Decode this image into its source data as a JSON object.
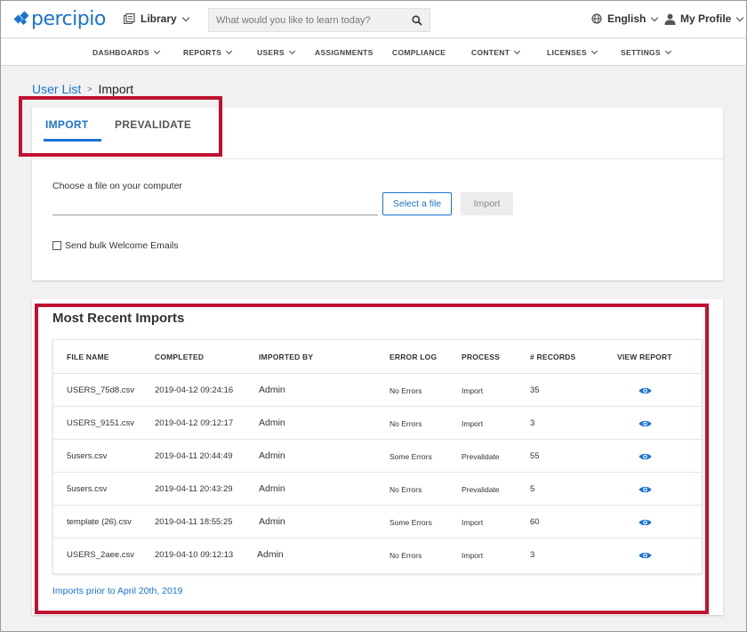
{
  "header": {
    "logo_text": "percipio",
    "library_label": "Library",
    "search_placeholder": "What would you like to learn today?",
    "language_label": "English",
    "profile_label": "My Profile"
  },
  "nav": {
    "items": [
      "DASHBOARDS",
      "REPORTS",
      "USERS",
      "ASSIGNMENTS",
      "COMPLIANCE",
      "CONTENT",
      "LICENSES",
      "SETTINGS"
    ]
  },
  "breadcrumb": {
    "parent": "User List",
    "separator": ">",
    "current": "Import"
  },
  "import_card": {
    "tabs": [
      "IMPORT",
      "PREVALIDATE"
    ],
    "active_tab": "IMPORT",
    "choose_label": "Choose a file on your computer",
    "select_button": "Select a file",
    "import_button": "Import",
    "welcome_checkbox_label": "Send bulk Welcome Emails",
    "welcome_checked": false
  },
  "recent_imports": {
    "title": "Most Recent Imports",
    "columns": [
      "FILE NAME",
      "COMPLETED",
      "IMPORTED BY",
      "ERROR LOG",
      "PROCESS",
      "# RECORDS",
      "VIEW REPORT"
    ],
    "rows": [
      {
        "file": "USERS_75d8.csv",
        "completed": "2019-04-12 09:24:16",
        "by": "Admin",
        "errors": "No Errors",
        "process": "Import",
        "records": "35"
      },
      {
        "file": "USERS_9151.csv",
        "completed": "2019-04-12 09:12:17",
        "by": "Admin",
        "errors": "No Errors",
        "process": "Import",
        "records": "3"
      },
      {
        "file": "5users.csv",
        "completed": "2019-04-11 20:44:49",
        "by": "Admin",
        "errors": "Some Errors",
        "process": "Prevalidate",
        "records": "55"
      },
      {
        "file": "5users.csv",
        "completed": "2019-04-11 20:43:29",
        "by": "Admin",
        "errors": "No Errors",
        "process": "Prevalidate",
        "records": "5"
      },
      {
        "file": "template (26).csv",
        "completed": "2019-04-11 18:55:25",
        "by": "Admin",
        "errors": "Some Errors",
        "process": "Import",
        "records": "60"
      },
      {
        "file": "USERS_2aee.csv",
        "completed": "2019-04-10 09:12:13",
        "by": "Admin",
        "errors": "No Errors",
        "process": "Import",
        "records": "3"
      }
    ],
    "older_link": "Imports prior to April 20th, 2019"
  },
  "colors": {
    "brand_blue": "#1b73d1",
    "highlight_red": "#c0112f"
  }
}
